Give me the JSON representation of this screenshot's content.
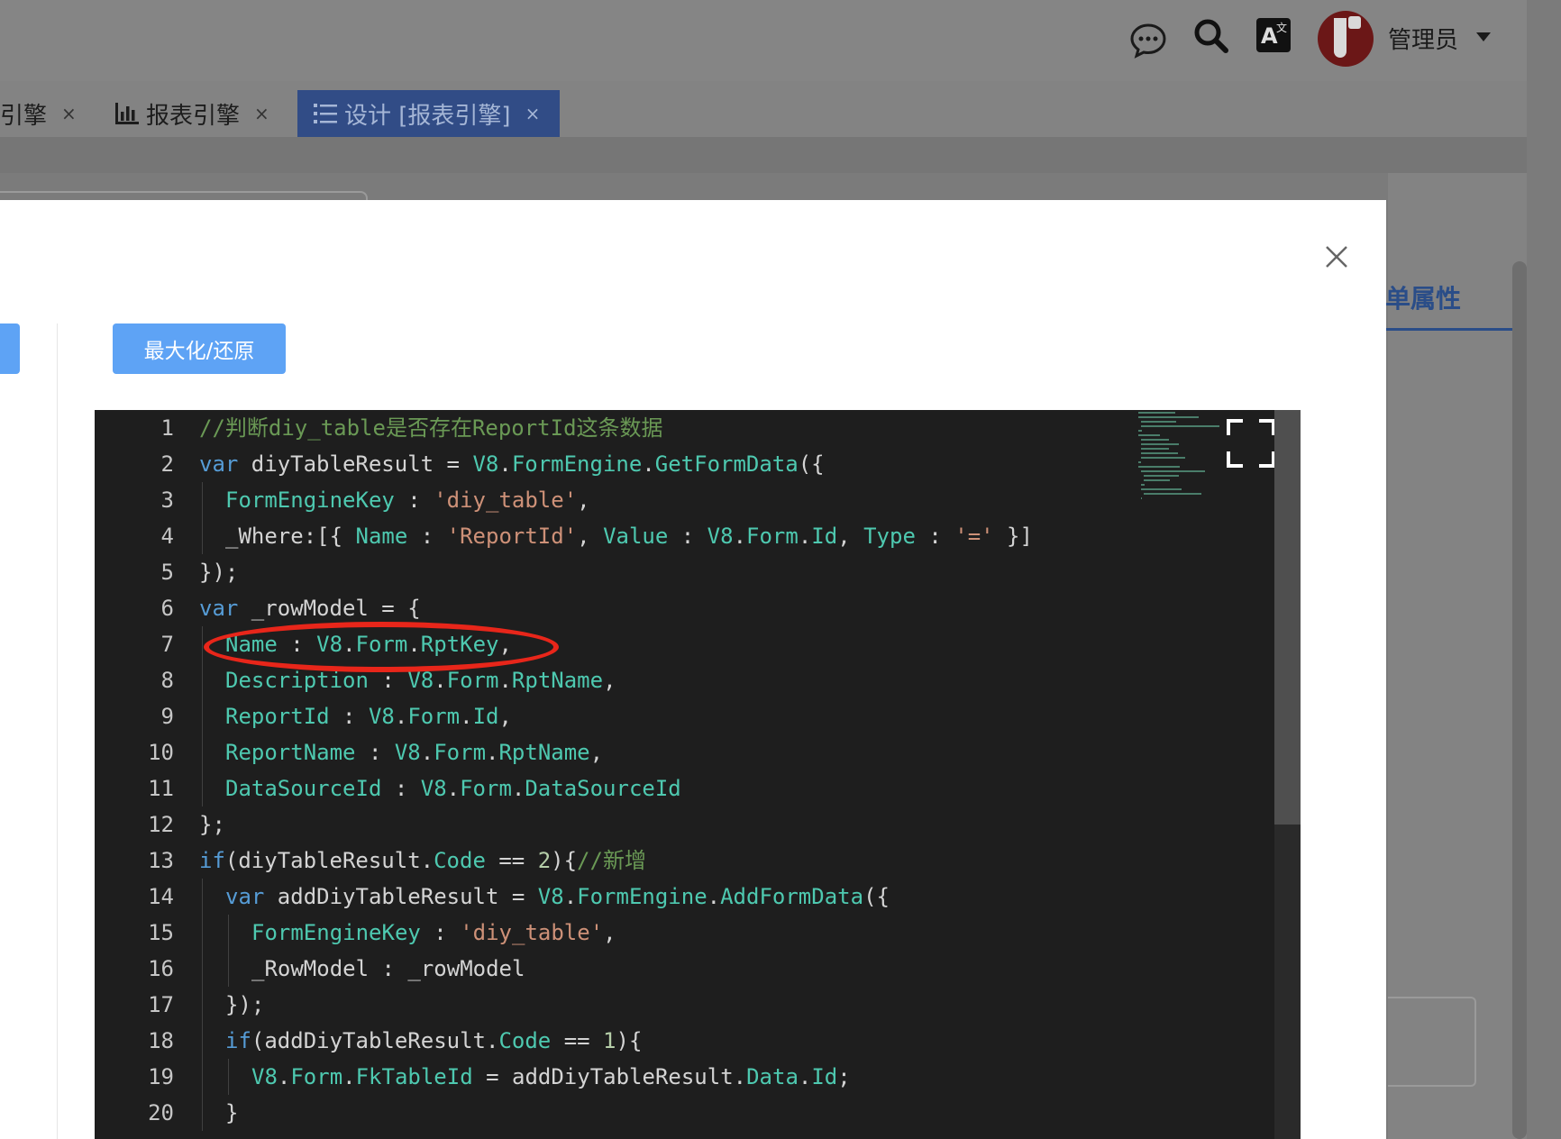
{
  "header": {
    "icons": [
      "chat-bubble-icon",
      "search-icon",
      "translate-icon"
    ],
    "translate_glyph": "A",
    "translate_sup": "文",
    "username": "管理员"
  },
  "tabs": [
    {
      "label": "引擎",
      "close": "×",
      "active": false
    },
    {
      "label": "报表引擎",
      "close": "×",
      "active": false,
      "icon": "bar-chart-icon"
    },
    {
      "label": "设计 [报表引擎]",
      "close": "×",
      "active": true,
      "icon": "list-icon"
    }
  ],
  "right_panel": {
    "tab_label": "单属性"
  },
  "modal": {
    "maximize_button": "最大化/还原"
  },
  "editor": {
    "lines": [
      {
        "n": "1",
        "indent": 0,
        "tokens": [
          {
            "t": "//判断diy_table是否存在ReportId这条数据",
            "c": "cmt"
          }
        ]
      },
      {
        "n": "2",
        "indent": 0,
        "tokens": [
          {
            "t": "var",
            "c": "kw"
          },
          {
            "t": " diyTableResult = ",
            "c": "plain"
          },
          {
            "t": "V8",
            "c": "prop"
          },
          {
            "t": ".",
            "c": "plain"
          },
          {
            "t": "FormEngine",
            "c": "prop"
          },
          {
            "t": ".",
            "c": "plain"
          },
          {
            "t": "GetFormData",
            "c": "prop"
          },
          {
            "t": "({",
            "c": "plain"
          }
        ]
      },
      {
        "n": "3",
        "indent": 1,
        "tokens": [
          {
            "t": "FormEngineKey",
            "c": "prop"
          },
          {
            "t": " : ",
            "c": "plain"
          },
          {
            "t": "'diy_table'",
            "c": "str"
          },
          {
            "t": ",",
            "c": "plain"
          }
        ]
      },
      {
        "n": "4",
        "indent": 1,
        "tokens": [
          {
            "t": "_Where:[{ ",
            "c": "plain"
          },
          {
            "t": "Name",
            "c": "prop"
          },
          {
            "t": " : ",
            "c": "plain"
          },
          {
            "t": "'ReportId'",
            "c": "str"
          },
          {
            "t": ", ",
            "c": "plain"
          },
          {
            "t": "Value",
            "c": "prop"
          },
          {
            "t": " : ",
            "c": "plain"
          },
          {
            "t": "V8",
            "c": "prop"
          },
          {
            "t": ".",
            "c": "plain"
          },
          {
            "t": "Form",
            "c": "prop"
          },
          {
            "t": ".",
            "c": "plain"
          },
          {
            "t": "Id",
            "c": "prop"
          },
          {
            "t": ", ",
            "c": "plain"
          },
          {
            "t": "Type",
            "c": "prop"
          },
          {
            "t": " : ",
            "c": "plain"
          },
          {
            "t": "'='",
            "c": "str"
          },
          {
            "t": " }]",
            "c": "plain"
          }
        ]
      },
      {
        "n": "5",
        "indent": 0,
        "tokens": [
          {
            "t": "});",
            "c": "plain"
          }
        ]
      },
      {
        "n": "6",
        "indent": 0,
        "tokens": [
          {
            "t": "var",
            "c": "kw"
          },
          {
            "t": " _rowModel = {",
            "c": "plain"
          }
        ]
      },
      {
        "n": "7",
        "indent": 1,
        "tokens": [
          {
            "t": "Name",
            "c": "prop"
          },
          {
            "t": " : ",
            "c": "plain"
          },
          {
            "t": "V8",
            "c": "prop"
          },
          {
            "t": ".",
            "c": "plain"
          },
          {
            "t": "Form",
            "c": "prop"
          },
          {
            "t": ".",
            "c": "plain"
          },
          {
            "t": "RptKey",
            "c": "prop"
          },
          {
            "t": ",",
            "c": "plain"
          }
        ]
      },
      {
        "n": "8",
        "indent": 1,
        "tokens": [
          {
            "t": "Description",
            "c": "prop"
          },
          {
            "t": " : ",
            "c": "plain"
          },
          {
            "t": "V8",
            "c": "prop"
          },
          {
            "t": ".",
            "c": "plain"
          },
          {
            "t": "Form",
            "c": "prop"
          },
          {
            "t": ".",
            "c": "plain"
          },
          {
            "t": "RptName",
            "c": "prop"
          },
          {
            "t": ",",
            "c": "plain"
          }
        ]
      },
      {
        "n": "9",
        "indent": 1,
        "tokens": [
          {
            "t": "ReportId",
            "c": "prop"
          },
          {
            "t": " : ",
            "c": "plain"
          },
          {
            "t": "V8",
            "c": "prop"
          },
          {
            "t": ".",
            "c": "plain"
          },
          {
            "t": "Form",
            "c": "prop"
          },
          {
            "t": ".",
            "c": "plain"
          },
          {
            "t": "Id",
            "c": "prop"
          },
          {
            "t": ",",
            "c": "plain"
          }
        ]
      },
      {
        "n": "10",
        "indent": 1,
        "tokens": [
          {
            "t": "ReportName",
            "c": "prop"
          },
          {
            "t": " : ",
            "c": "plain"
          },
          {
            "t": "V8",
            "c": "prop"
          },
          {
            "t": ".",
            "c": "plain"
          },
          {
            "t": "Form",
            "c": "prop"
          },
          {
            "t": ".",
            "c": "plain"
          },
          {
            "t": "RptName",
            "c": "prop"
          },
          {
            "t": ",",
            "c": "plain"
          }
        ]
      },
      {
        "n": "11",
        "indent": 1,
        "tokens": [
          {
            "t": "DataSourceId",
            "c": "prop"
          },
          {
            "t": " : ",
            "c": "plain"
          },
          {
            "t": "V8",
            "c": "prop"
          },
          {
            "t": ".",
            "c": "plain"
          },
          {
            "t": "Form",
            "c": "prop"
          },
          {
            "t": ".",
            "c": "plain"
          },
          {
            "t": "DataSourceId",
            "c": "prop"
          }
        ]
      },
      {
        "n": "12",
        "indent": 0,
        "tokens": [
          {
            "t": "};",
            "c": "plain"
          }
        ]
      },
      {
        "n": "13",
        "indent": 0,
        "tokens": [
          {
            "t": "if",
            "c": "kw"
          },
          {
            "t": "(diyTableResult.",
            "c": "plain"
          },
          {
            "t": "Code",
            "c": "prop"
          },
          {
            "t": " == ",
            "c": "plain"
          },
          {
            "t": "2",
            "c": "num"
          },
          {
            "t": "){",
            "c": "plain"
          },
          {
            "t": "//新增",
            "c": "cmt"
          }
        ]
      },
      {
        "n": "14",
        "indent": 1,
        "tokens": [
          {
            "t": "var",
            "c": "kw"
          },
          {
            "t": " addDiyTableResult = ",
            "c": "plain"
          },
          {
            "t": "V8",
            "c": "prop"
          },
          {
            "t": ".",
            "c": "plain"
          },
          {
            "t": "FormEngine",
            "c": "prop"
          },
          {
            "t": ".",
            "c": "plain"
          },
          {
            "t": "AddFormData",
            "c": "prop"
          },
          {
            "t": "({",
            "c": "plain"
          }
        ]
      },
      {
        "n": "15",
        "indent": 2,
        "tokens": [
          {
            "t": "FormEngineKey",
            "c": "prop"
          },
          {
            "t": " : ",
            "c": "plain"
          },
          {
            "t": "'diy_table'",
            "c": "str"
          },
          {
            "t": ",",
            "c": "plain"
          }
        ]
      },
      {
        "n": "16",
        "indent": 2,
        "tokens": [
          {
            "t": "_RowModel : _rowModel",
            "c": "plain"
          }
        ]
      },
      {
        "n": "17",
        "indent": 1,
        "tokens": [
          {
            "t": "});",
            "c": "plain"
          }
        ]
      },
      {
        "n": "18",
        "indent": 1,
        "tokens": [
          {
            "t": "if",
            "c": "kw"
          },
          {
            "t": "(addDiyTableResult.",
            "c": "plain"
          },
          {
            "t": "Code",
            "c": "prop"
          },
          {
            "t": " == ",
            "c": "plain"
          },
          {
            "t": "1",
            "c": "num"
          },
          {
            "t": "){",
            "c": "plain"
          }
        ]
      },
      {
        "n": "19",
        "indent": 2,
        "tokens": [
          {
            "t": "V8",
            "c": "prop"
          },
          {
            "t": ".",
            "c": "plain"
          },
          {
            "t": "Form",
            "c": "prop"
          },
          {
            "t": ".",
            "c": "plain"
          },
          {
            "t": "FkTableId",
            "c": "prop"
          },
          {
            "t": " = addDiyTableResult.",
            "c": "plain"
          },
          {
            "t": "Data",
            "c": "prop"
          },
          {
            "t": ".",
            "c": "plain"
          },
          {
            "t": "Id",
            "c": "prop"
          },
          {
            "t": ";",
            "c": "plain"
          }
        ]
      },
      {
        "n": "20",
        "indent": 1,
        "tokens": [
          {
            "t": "}",
            "c": "plain"
          }
        ]
      }
    ]
  },
  "annotation": {
    "color": "#e8261a",
    "target_line": "7"
  },
  "colors": {
    "accent": "#5ea3f5",
    "tab_active_bg": "#314c86",
    "editor_bg": "#1e1e1e"
  }
}
